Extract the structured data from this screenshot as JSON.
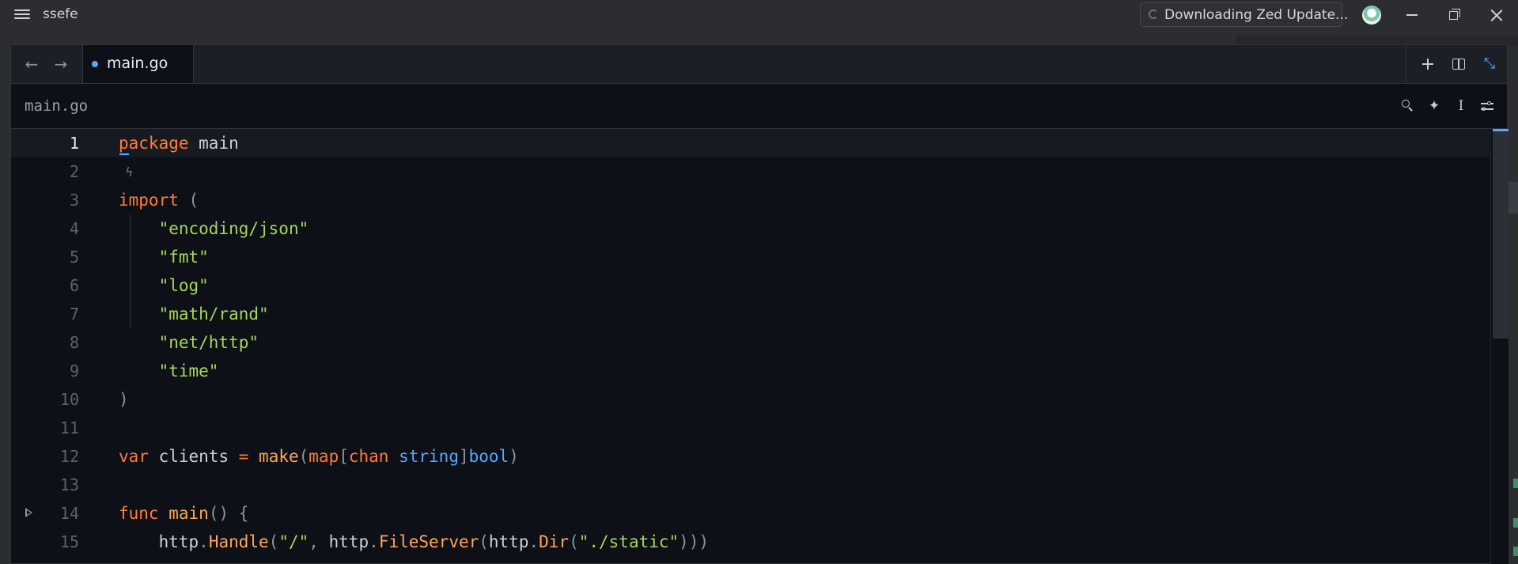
{
  "titlebar": {
    "project_name": "ssefe",
    "update_status": "Downloading Zed Update...",
    "icons": [
      "hamburger-menu-icon",
      "spinner-icon",
      "avatar",
      "minimize-icon",
      "restore-icon",
      "close-icon"
    ]
  },
  "tabbar": {
    "tabs": [
      {
        "label": "main.go",
        "modified": true,
        "active": true
      }
    ],
    "icons": [
      "arrow-left-icon",
      "arrow-right-icon",
      "plus-icon",
      "split-pane-icon",
      "collapse-icon"
    ]
  },
  "breadcrumb": {
    "path": "main.go",
    "icons": [
      "search-icon",
      "assistant-sparkle-icon",
      "text-cursor-icon",
      "settings-sliders-icon"
    ]
  },
  "editor": {
    "active_line": 1,
    "line_numbers": [
      "1",
      "2",
      "3",
      "4",
      "5",
      "6",
      "7",
      "8",
      "9",
      "10",
      "11",
      "12",
      "13",
      "14",
      "15"
    ],
    "code_lines": [
      "package main",
      "",
      "import (",
      "    \"encoding/json\"",
      "    \"fmt\"",
      "    \"log\"",
      "    \"math/rand\"",
      "    \"net/http\"",
      "    \"time\"",
      ")",
      "",
      "var clients = make(map[chan string]bool)",
      "",
      "func main() {",
      "    http.Handle(\"/\", http.FileServer(http.Dir(\"./static\")))"
    ]
  },
  "colors": {
    "keyword": "#ff7b3c",
    "string": "#a5d65b",
    "type": "#58a6ff",
    "function": "#ffa657",
    "accent": "#58a6ff",
    "editor_bg": "#0d1117"
  }
}
